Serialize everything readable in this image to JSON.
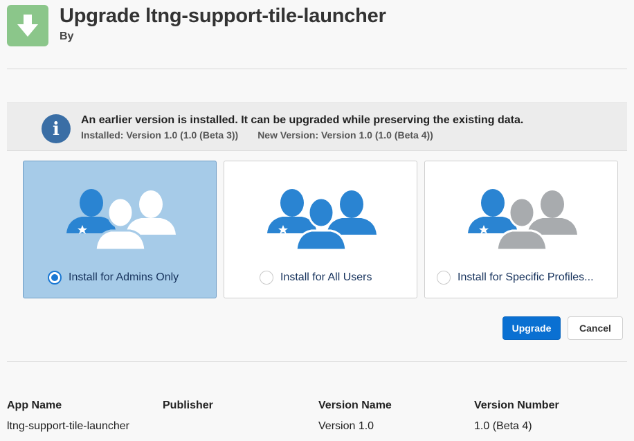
{
  "header": {
    "title": "Upgrade ltng-support-tile-launcher",
    "by_label": "By",
    "icon": "download-arrow-icon",
    "icon_color": "#8bc68a"
  },
  "info": {
    "icon": "info-icon",
    "message": "An earlier version is installed. It can be upgraded while preserving the existing data.",
    "installed": "Installed: Version 1.0 (1.0 (Beta 3))",
    "new_version": "New Version: Version 1.0 (1.0 (Beta 4))"
  },
  "install_options": [
    {
      "label": "Install for Admins Only",
      "selected": true,
      "icon": "admins-group-icon"
    },
    {
      "label": "Install for All Users",
      "selected": false,
      "icon": "all-users-group-icon"
    },
    {
      "label": "Install for Specific Profiles...",
      "selected": false,
      "icon": "profiles-group-icon"
    }
  ],
  "buttons": {
    "upgrade": "Upgrade",
    "cancel": "Cancel"
  },
  "details": {
    "headers": [
      "App Name",
      "Publisher",
      "Version Name",
      "Version Number"
    ],
    "values": [
      "ltng-support-tile-launcher",
      "",
      "Version 1.0",
      "1.0 (Beta 4)"
    ]
  },
  "colors": {
    "accent": "#0a70d2",
    "selected_card": "#a6cbe8",
    "person_blue": "#2a84d2",
    "person_gray": "#a8abae"
  }
}
